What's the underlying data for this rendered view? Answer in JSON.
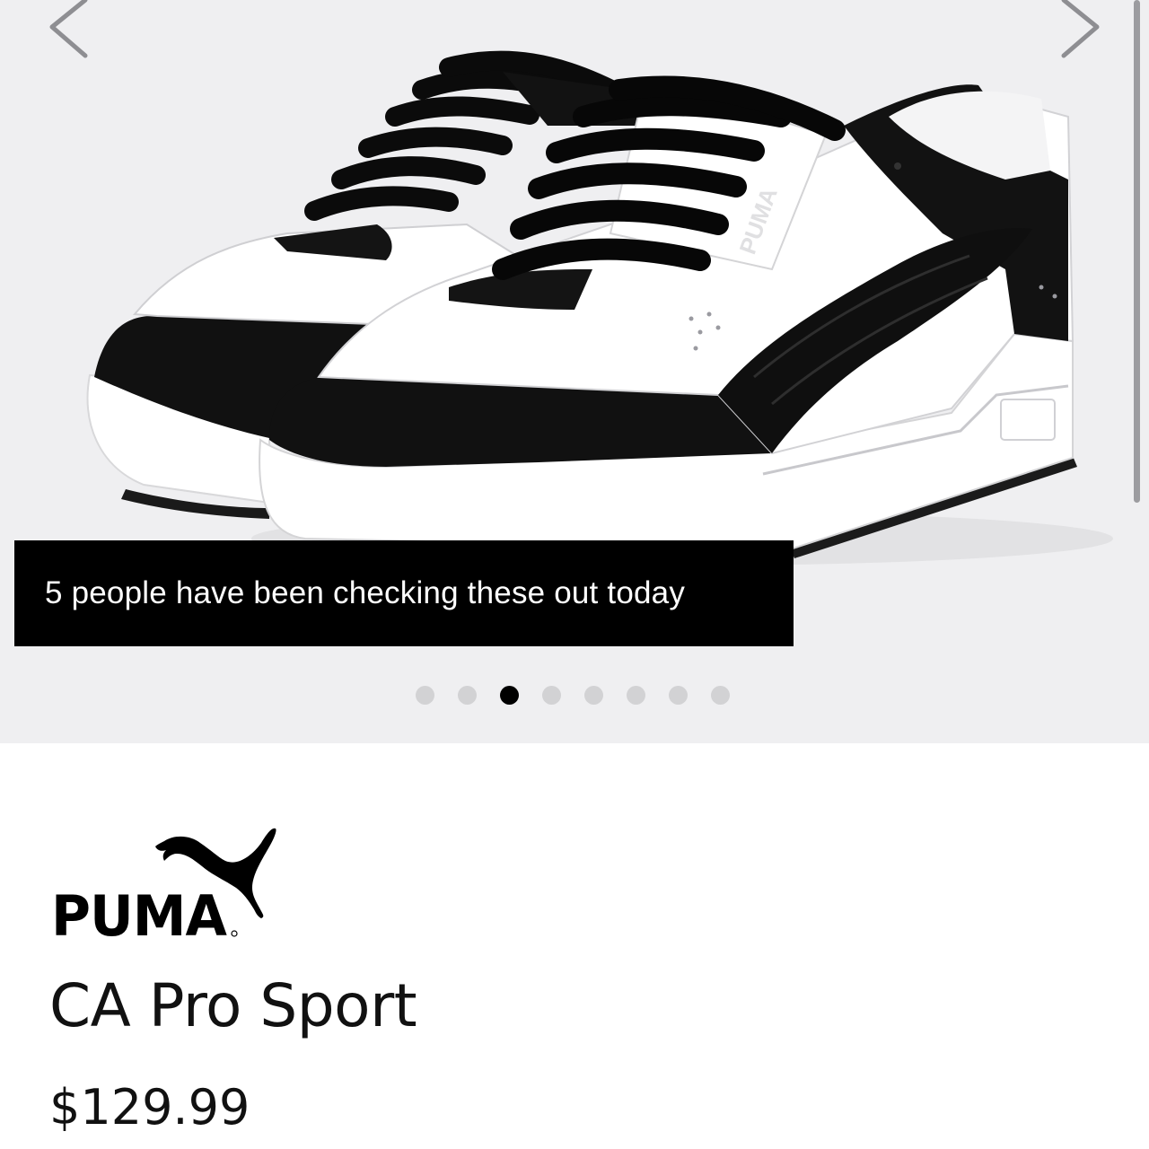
{
  "gallery": {
    "banner_text": "5 people have been checking these out today",
    "slide_count": 8,
    "active_slide": 3,
    "shoe_logo_text": "PUMA",
    "prev_icon": "chevron-left-icon",
    "next_icon": "chevron-right-icon"
  },
  "product": {
    "brand": "PUMA",
    "name": "CA Pro Sport",
    "price": "$129.99"
  },
  "colors": {
    "gallery_bg": "#efeff1",
    "banner_bg": "#000000",
    "dot_inactive": "#d2d2d4",
    "dot_active": "#000000"
  }
}
